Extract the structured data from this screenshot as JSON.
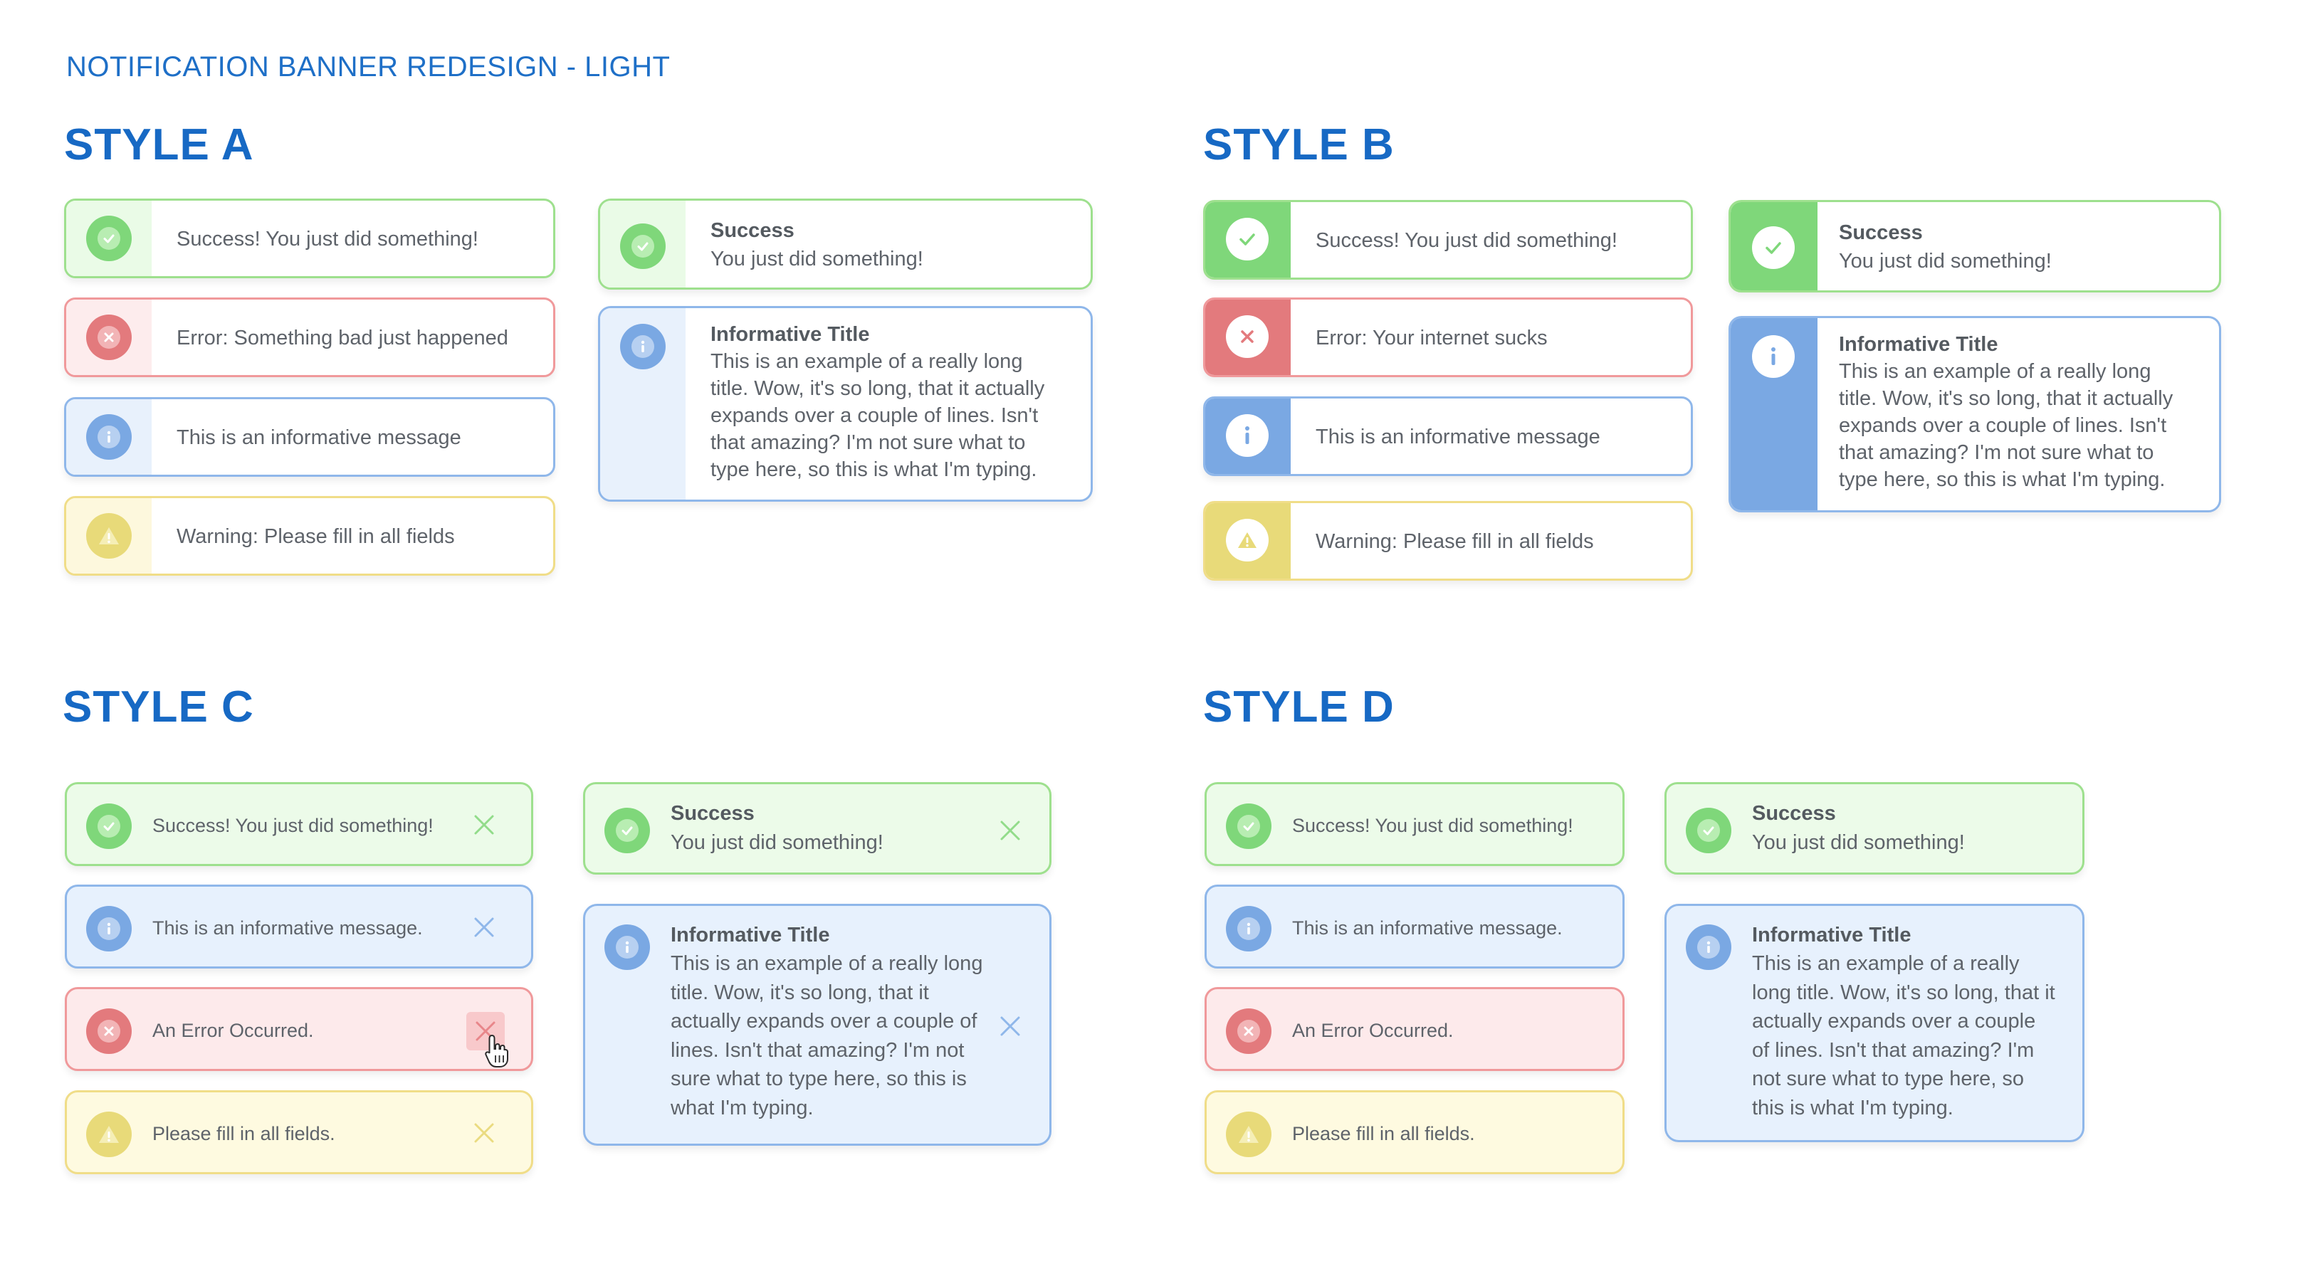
{
  "page_title": "NOTIFICATION BANNER REDESIGN - LIGHT",
  "colors": {
    "accent_blue": "#1769c4",
    "success": "#7fd77a",
    "error": "#e37a7d",
    "info": "#7aa8e3",
    "warning": "#e8da79"
  },
  "styles": {
    "a": {
      "heading": "STYLE A",
      "success": "Success! You just did something!",
      "error": "Error: Something bad just happened",
      "info": "This is an informative message",
      "warning": "Warning: Please fill in all fields",
      "success_title": "Success",
      "success_body": "You just did something!",
      "info_title": "Informative Title",
      "info_lines": [
        "This is an example of a really long",
        "title. Wow, it's so long, that it actually",
        "expands over a couple of lines. Isn't",
        "that amazing? I'm not sure what to",
        "type here, so this is what I'm typing."
      ]
    },
    "b": {
      "heading": "STYLE B",
      "success": "Success! You just did something!",
      "error": "Error: Your internet sucks",
      "info": "This is an informative message",
      "warning": "Warning: Please fill in all fields",
      "success_title": "Success",
      "success_body": "You just did something!",
      "info_title": "Informative Title",
      "info_lines": [
        "This is an example of a really long",
        "title. Wow, it's so long, that it actually",
        "expands over a couple of lines. Isn't",
        "that amazing? I'm not sure what to",
        "type here, so this is what I'm typing."
      ]
    },
    "c": {
      "heading": "STYLE C",
      "success": "Success! You just did something!",
      "info": "This is an informative message.",
      "error": "An Error Occurred.",
      "warning": "Please fill in all fields.",
      "success_title": "Success",
      "success_body": "You just did something!",
      "info_title": "Informative Title",
      "info_lines": [
        "This is an example of a really long",
        "title. Wow, it's so long, that it",
        "actually expands over a couple of",
        "lines. Isn't that amazing? I'm not",
        "sure what to type here, so this is",
        "what I'm typing."
      ]
    },
    "d": {
      "heading": "STYLE D",
      "success": "Success! You just did something!",
      "info": "This is an informative message.",
      "error": "An Error Occurred.",
      "warning": "Please fill in all fields.",
      "success_title": "Success",
      "success_body": "You just did something!",
      "info_title": "Informative Title",
      "info_lines": [
        "This is an example of a really",
        "long title. Wow, it's so long, that it",
        "actually expands over a couple",
        "of lines. Isn't that amazing? I'm",
        "not sure what to type here, so",
        "this is what I'm typing."
      ]
    }
  }
}
